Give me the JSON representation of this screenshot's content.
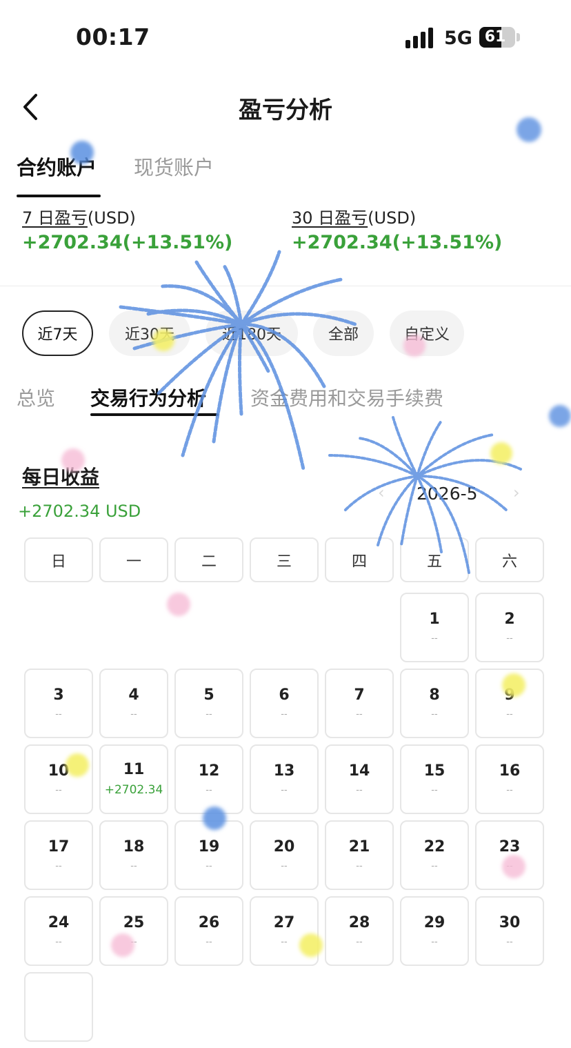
{
  "status_bar": {
    "time": "00:17",
    "network": "5G",
    "battery": "61"
  },
  "header": {
    "title": "盈亏分析"
  },
  "account_tabs": [
    {
      "label": "合约账户",
      "active": true
    },
    {
      "label": "现货账户",
      "active": false
    }
  ],
  "pnl": {
    "seven_day": {
      "label_underlined": "7 日盈亏",
      "unit": "(USD)",
      "value": "+2702.34(+13.51%)"
    },
    "thirty_day": {
      "label_underlined": "30 日盈亏",
      "unit": "(USD)",
      "value": "+2702.34(+13.51%)"
    }
  },
  "range_filters": [
    {
      "label": "近7天",
      "active": true
    },
    {
      "label": "近30天",
      "active": false
    },
    {
      "label": "近180天",
      "active": false
    },
    {
      "label": "全部",
      "active": false
    },
    {
      "label": "自定义",
      "active": false
    }
  ],
  "section_tabs": [
    {
      "label": "总览",
      "active": false
    },
    {
      "label": "交易行为分析",
      "active": true
    },
    {
      "label": "资金费用和交易手续费",
      "active": false
    }
  ],
  "daily_income": {
    "title": "每日收益",
    "total": "+2702.34 USD",
    "month": "2026-5"
  },
  "calendar": {
    "weekdays": [
      "日",
      "一",
      "二",
      "三",
      "四",
      "五",
      "六"
    ],
    "weeks": [
      [
        null,
        null,
        null,
        null,
        null,
        {
          "day": "1",
          "value": "--"
        },
        {
          "day": "2",
          "value": "--"
        }
      ],
      [
        {
          "day": "3",
          "value": "--"
        },
        {
          "day": "4",
          "value": "--"
        },
        {
          "day": "5",
          "value": "--"
        },
        {
          "day": "6",
          "value": "--"
        },
        {
          "day": "7",
          "value": "--"
        },
        {
          "day": "8",
          "value": "--"
        },
        {
          "day": "9",
          "value": "--"
        }
      ],
      [
        {
          "day": "10",
          "value": "--"
        },
        {
          "day": "11",
          "value": "+2702.34",
          "positive": true
        },
        {
          "day": "12",
          "value": "--"
        },
        {
          "day": "13",
          "value": "--"
        },
        {
          "day": "14",
          "value": "--"
        },
        {
          "day": "15",
          "value": "--"
        },
        {
          "day": "16",
          "value": "--"
        }
      ],
      [
        {
          "day": "17",
          "value": "--"
        },
        {
          "day": "18",
          "value": "--"
        },
        {
          "day": "19",
          "value": "--"
        },
        {
          "day": "20",
          "value": "--"
        },
        {
          "day": "21",
          "value": "--"
        },
        {
          "day": "22",
          "value": "--"
        },
        {
          "day": "23",
          "value": "--"
        }
      ],
      [
        {
          "day": "24",
          "value": "--"
        },
        {
          "day": "25",
          "value": "--"
        },
        {
          "day": "26",
          "value": "--"
        },
        {
          "day": "27",
          "value": "--"
        },
        {
          "day": "28",
          "value": "--"
        },
        {
          "day": "29",
          "value": "--"
        },
        {
          "day": "30",
          "value": "--"
        }
      ],
      [
        {
          "day": "",
          "value": ""
        }
      ]
    ]
  },
  "colors": {
    "positive": "#3aa13a",
    "firework_blue": "#5b8fe0",
    "dot_pink": "#f6bcd6",
    "dot_yellow": "#f4f06a"
  },
  "icons": {
    "back": "chevron-left-icon",
    "prev_month": "chevron-left-icon",
    "next_month": "chevron-right-icon"
  }
}
